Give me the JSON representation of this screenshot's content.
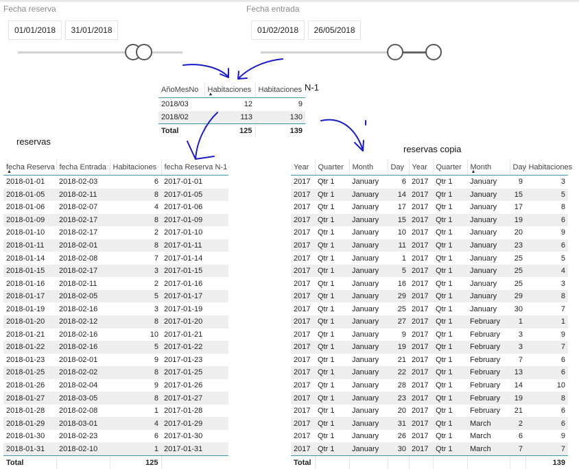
{
  "slicer_reserva": {
    "title": "Fecha reserva",
    "start": "01/01/2018",
    "end": "31/01/2018"
  },
  "slicer_entrada": {
    "title": "Fecha entrada",
    "start": "01/02/2018",
    "end": "26/05/2018"
  },
  "summary": {
    "headers": [
      "AñoMesNo",
      "Habitaciones",
      "Habitaciones"
    ],
    "extra_label": "N-1",
    "rows": [
      [
        "2018/03",
        "12",
        "9"
      ],
      [
        "2018/02",
        "113",
        "130"
      ]
    ],
    "total": [
      "Total",
      "125",
      "139"
    ]
  },
  "reservas": {
    "title": "reservas",
    "headers": [
      "fecha Reserva",
      "fecha Entrada",
      "Habitaciones",
      "fecha Reserva N-1"
    ],
    "rows": [
      [
        "2018-01-01",
        "2018-02-03",
        "6",
        "2017-01-01"
      ],
      [
        "2018-01-05",
        "2018-02-11",
        "8",
        "2017-01-05"
      ],
      [
        "2018-01-06",
        "2018-02-07",
        "4",
        "2017-01-06"
      ],
      [
        "2018-01-09",
        "2018-02-17",
        "8",
        "2017-01-09"
      ],
      [
        "2018-01-10",
        "2018-02-17",
        "2",
        "2017-01-10"
      ],
      [
        "2018-01-11",
        "2018-02-01",
        "8",
        "2017-01-11"
      ],
      [
        "2018-01-14",
        "2018-02-08",
        "7",
        "2017-01-14"
      ],
      [
        "2018-01-15",
        "2018-02-17",
        "3",
        "2017-01-15"
      ],
      [
        "2018-01-16",
        "2018-02-11",
        "2",
        "2017-01-16"
      ],
      [
        "2018-01-17",
        "2018-02-05",
        "5",
        "2017-01-17"
      ],
      [
        "2018-01-19",
        "2018-02-16",
        "3",
        "2017-01-19"
      ],
      [
        "2018-01-20",
        "2018-02-12",
        "8",
        "2017-01-20"
      ],
      [
        "2018-01-21",
        "2018-02-16",
        "10",
        "2017-01-21"
      ],
      [
        "2018-01-22",
        "2018-02-16",
        "5",
        "2017-01-22"
      ],
      [
        "2018-01-23",
        "2018-02-01",
        "9",
        "2017-01-23"
      ],
      [
        "2018-01-25",
        "2018-02-02",
        "8",
        "2017-01-25"
      ],
      [
        "2018-01-26",
        "2018-02-04",
        "9",
        "2017-01-26"
      ],
      [
        "2018-01-27",
        "2018-03-05",
        "8",
        "2017-01-27"
      ],
      [
        "2018-01-28",
        "2018-02-08",
        "1",
        "2017-01-28"
      ],
      [
        "2018-01-29",
        "2018-03-01",
        "4",
        "2017-01-29"
      ],
      [
        "2018-01-30",
        "2018-02-23",
        "6",
        "2017-01-30"
      ],
      [
        "2018-01-31",
        "2018-02-10",
        "1",
        "2017-01-31"
      ]
    ],
    "total": [
      "Total",
      "",
      "125",
      ""
    ]
  },
  "copia": {
    "title": "reservas copia",
    "headers": [
      "Year",
      "Quarter",
      "Month",
      "Day",
      "Year",
      "Quarter",
      "Month",
      "Day",
      "Habitaciones"
    ],
    "rows": [
      [
        "2017",
        "Qtr 1",
        "January",
        "6",
        "2017",
        "Qtr 1",
        "January",
        "9",
        "3"
      ],
      [
        "2017",
        "Qtr 1",
        "January",
        "14",
        "2017",
        "Qtr 1",
        "January",
        "15",
        "5"
      ],
      [
        "2017",
        "Qtr 1",
        "January",
        "17",
        "2017",
        "Qtr 1",
        "January",
        "17",
        "8"
      ],
      [
        "2017",
        "Qtr 1",
        "January",
        "15",
        "2017",
        "Qtr 1",
        "January",
        "19",
        "6"
      ],
      [
        "2017",
        "Qtr 1",
        "January",
        "10",
        "2017",
        "Qtr 1",
        "January",
        "20",
        "9"
      ],
      [
        "2017",
        "Qtr 1",
        "January",
        "11",
        "2017",
        "Qtr 1",
        "January",
        "23",
        "6"
      ],
      [
        "2017",
        "Qtr 1",
        "January",
        "1",
        "2017",
        "Qtr 1",
        "January",
        "25",
        "5"
      ],
      [
        "2017",
        "Qtr 1",
        "January",
        "5",
        "2017",
        "Qtr 1",
        "January",
        "25",
        "4"
      ],
      [
        "2017",
        "Qtr 1",
        "January",
        "16",
        "2017",
        "Qtr 1",
        "January",
        "25",
        "3"
      ],
      [
        "2017",
        "Qtr 1",
        "January",
        "29",
        "2017",
        "Qtr 1",
        "January",
        "29",
        "8"
      ],
      [
        "2017",
        "Qtr 1",
        "January",
        "25",
        "2017",
        "Qtr 1",
        "January",
        "30",
        "7"
      ],
      [
        "2017",
        "Qtr 1",
        "January",
        "27",
        "2017",
        "Qtr 1",
        "February",
        "1",
        "1"
      ],
      [
        "2017",
        "Qtr 1",
        "January",
        "9",
        "2017",
        "Qtr 1",
        "February",
        "3",
        "9"
      ],
      [
        "2017",
        "Qtr 1",
        "January",
        "19",
        "2017",
        "Qtr 1",
        "February",
        "3",
        "7"
      ],
      [
        "2017",
        "Qtr 1",
        "January",
        "21",
        "2017",
        "Qtr 1",
        "February",
        "7",
        "6"
      ],
      [
        "2017",
        "Qtr 1",
        "January",
        "22",
        "2017",
        "Qtr 1",
        "February",
        "13",
        "6"
      ],
      [
        "2017",
        "Qtr 1",
        "January",
        "28",
        "2017",
        "Qtr 1",
        "February",
        "14",
        "10"
      ],
      [
        "2017",
        "Qtr 1",
        "January",
        "23",
        "2017",
        "Qtr 1",
        "February",
        "19",
        "8"
      ],
      [
        "2017",
        "Qtr 1",
        "January",
        "20",
        "2017",
        "Qtr 1",
        "February",
        "21",
        "6"
      ],
      [
        "2017",
        "Qtr 1",
        "January",
        "31",
        "2017",
        "Qtr 1",
        "March",
        "2",
        "6"
      ],
      [
        "2017",
        "Qtr 1",
        "January",
        "26",
        "2017",
        "Qtr 1",
        "March",
        "6",
        "9"
      ],
      [
        "2017",
        "Qtr 1",
        "January",
        "30",
        "2017",
        "Qtr 1",
        "March",
        "7",
        "7"
      ]
    ],
    "total": [
      "Total",
      "",
      "",
      "",
      "",
      "",
      "",
      "",
      "139"
    ]
  }
}
